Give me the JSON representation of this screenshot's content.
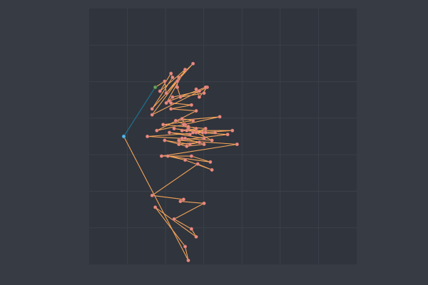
{
  "chart_data": {
    "type": "line",
    "title": "",
    "xlabel": "",
    "ylabel": "",
    "xlim": [
      -0.4,
      1.3
    ],
    "ylim": [
      -0.65,
      0.65
    ],
    "grid": true,
    "legend": "none",
    "colors": {
      "background": "#363b44",
      "plot_background": "#30343c",
      "grid": "#3b4049",
      "path_line": "#f3a45a",
      "start_line": "#1f6b85",
      "point_fill": "#e88c84",
      "point_stroke": "#c46d66",
      "root_point": "#57b7e6",
      "start_point": "#6aa35c"
    },
    "root": {
      "x": -0.18,
      "y": 0.0
    },
    "start": {
      "x": 0.02,
      "y": 0.25
    },
    "series": [
      {
        "path": [
          [
            0.02,
            0.25
          ],
          [
            0.08,
            0.28
          ],
          [
            0.09,
            0.22
          ],
          [
            0.17,
            0.3
          ],
          [
            0.26,
            0.37
          ],
          [
            0.0,
            0.14
          ],
          [
            0.13,
            0.3
          ],
          [
            0.12,
            0.32
          ],
          [
            0.05,
            0.23
          ],
          [
            0.21,
            0.34
          ],
          [
            0.09,
            0.17
          ],
          [
            0.13,
            0.2
          ],
          [
            0.3,
            0.23
          ],
          [
            0.28,
            0.24
          ],
          [
            0.3,
            0.2
          ],
          [
            0.35,
            0.25
          ],
          [
            0.0,
            0.11
          ],
          [
            0.16,
            0.28
          ],
          [
            0.16,
            0.25
          ],
          [
            0.18,
            0.2
          ],
          [
            0.33,
            0.22
          ],
          [
            0.34,
            0.25
          ],
          [
            0.11,
            0.18
          ],
          [
            0.12,
            0.17
          ],
          [
            0.25,
            0.16
          ],
          [
            0.12,
            0.14
          ],
          [
            0.28,
            0.13
          ],
          [
            0.03,
            0.03
          ],
          [
            0.43,
            0.1
          ],
          [
            0.15,
            0.08
          ],
          [
            0.21,
            0.06
          ],
          [
            0.19,
            0.09
          ],
          [
            0.26,
            0.08
          ],
          [
            0.07,
            0.06
          ],
          [
            0.34,
            0.04
          ],
          [
            0.24,
            0.01
          ],
          [
            0.11,
            0.02
          ],
          [
            0.33,
            -0.01
          ],
          [
            0.32,
            0.02
          ],
          [
            0.14,
            0.04
          ],
          [
            0.34,
            0.02
          ],
          [
            0.23,
            0.04
          ],
          [
            0.26,
            0.02
          ],
          [
            0.2,
            0.06
          ],
          [
            0.23,
            0.05
          ],
          [
            0.28,
            0.04
          ],
          [
            0.22,
            0.03
          ],
          [
            0.4,
            0.02
          ],
          [
            0.19,
            0.03
          ],
          [
            0.51,
            0.03
          ],
          [
            -0.03,
            0.0
          ],
          [
            0.19,
            -0.01
          ],
          [
            0.17,
            -0.04
          ],
          [
            0.3,
            -0.03
          ],
          [
            0.24,
            -0.04
          ],
          [
            0.08,
            -0.02
          ],
          [
            0.22,
            -0.05
          ],
          [
            0.33,
            -0.04
          ],
          [
            0.21,
            -0.01
          ],
          [
            0.38,
            -0.02
          ],
          [
            0.28,
            0.02
          ],
          [
            0.48,
            0.01
          ],
          [
            0.17,
            -0.02
          ],
          [
            0.54,
            -0.04
          ],
          [
            0.06,
            -0.1
          ],
          [
            0.25,
            -0.1
          ],
          [
            0.37,
            -0.13
          ],
          [
            0.1,
            -0.1
          ],
          [
            0.21,
            -0.12
          ],
          [
            0.38,
            -0.17
          ],
          [
            0.29,
            -0.14
          ],
          [
            0.0,
            -0.3
          ],
          [
            0.2,
            -0.32
          ],
          [
            0.18,
            -0.33
          ],
          [
            0.33,
            -0.34
          ],
          [
            0.14,
            -0.42
          ],
          [
            0.25,
            -0.47
          ],
          [
            0.28,
            -0.51
          ],
          [
            0.02,
            -0.36
          ],
          [
            0.21,
            -0.56
          ],
          [
            0.23,
            -0.63
          ]
        ]
      }
    ]
  }
}
